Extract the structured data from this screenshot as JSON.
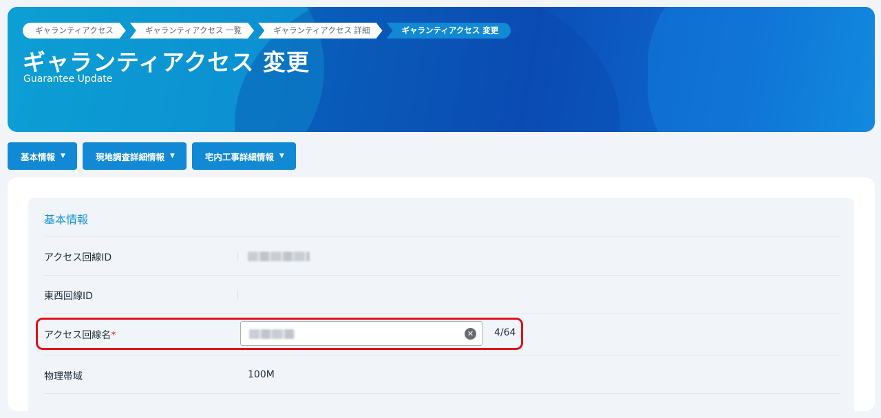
{
  "breadcrumb": [
    {
      "label": "ギャランティアクセス"
    },
    {
      "label": "ギャランティアクセス 一覧"
    },
    {
      "label": "ギャランティアクセス 詳細"
    },
    {
      "label": "ギャランティアクセス 変更"
    }
  ],
  "header": {
    "title": "ギャランティアクセス 変更",
    "subtitle": "Guarantee Update"
  },
  "tabs": [
    {
      "label": "基本情報"
    },
    {
      "label": "現地調査詳細情報"
    },
    {
      "label": "宅内工事詳細情報"
    }
  ],
  "section": {
    "title": "基本情報",
    "rows": [
      {
        "label": "アクセス回線ID",
        "value": ""
      },
      {
        "label": "東西回線ID",
        "value": ""
      },
      {
        "label": "アクセス回線名",
        "required_mark": "*",
        "counter": "4/64"
      },
      {
        "label": "物理帯域",
        "value": "100M"
      }
    ]
  },
  "colors": {
    "accent": "#1189d4",
    "required": "#e02424",
    "highlight": "#e0101a"
  }
}
